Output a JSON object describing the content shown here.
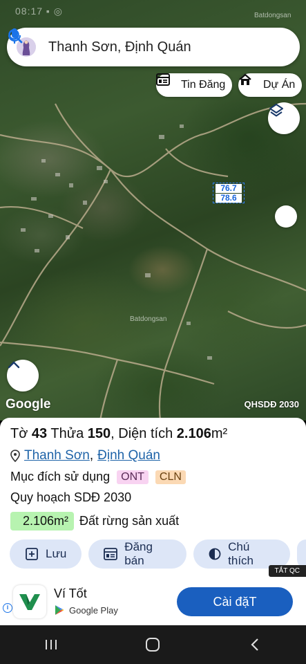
{
  "status": {
    "faded_time": "08:17 ▪ ◎"
  },
  "watermarks": {
    "top": "Batdongsan",
    "center": "Batdongsan"
  },
  "search": {
    "text": "Thanh Sơn, Định Quán",
    "icon": "search-icon",
    "mic_icon": "microphone-icon"
  },
  "chips": [
    {
      "label": "Tin Đăng",
      "icon": "listing-icon"
    },
    {
      "label": "Dự Án",
      "icon": "project-house-icon"
    }
  ],
  "map": {
    "measure_top": "76.7",
    "measure_bottom": "78.6",
    "google": "Google",
    "layer_label": "QHSDĐ 2030"
  },
  "parcel": {
    "to_label": "Tờ",
    "to_value": "43",
    "thua_label": "Thửa",
    "thua_value": "150",
    "area_label": ", Diện tích",
    "area_value": "2.106",
    "area_unit": "m²",
    "location_icon": "pin-icon",
    "ward": "Thanh Sơn",
    "district": "Định Quán",
    "purpose_label": "Mục đích sử dụng",
    "purpose_tags": [
      "ONT",
      "CLN"
    ],
    "plan_label": "Quy hoạch SDĐ 2030",
    "plan_area": "2.106m²",
    "plan_type": "Đất rừng sản xuất"
  },
  "actions": [
    {
      "label": "Lưu",
      "icon": "add-bookmark-icon"
    },
    {
      "label": "Đăng bán",
      "icon": "listing-icon"
    },
    {
      "label": "Chú thích",
      "icon": "half-circle-icon"
    }
  ],
  "ad": {
    "close_label": "TẮT QC",
    "app_name": "Ví Tốt",
    "store": "Google Play",
    "cta": "Cài đặT"
  },
  "colors": {
    "accent": "#1a5fbf",
    "link": "#1e63a8",
    "tag_ont": "#f8d3f1",
    "tag_cln": "#fbd9b4",
    "area_badge": "#b7f3b0",
    "action_bg": "#dde6f7"
  }
}
